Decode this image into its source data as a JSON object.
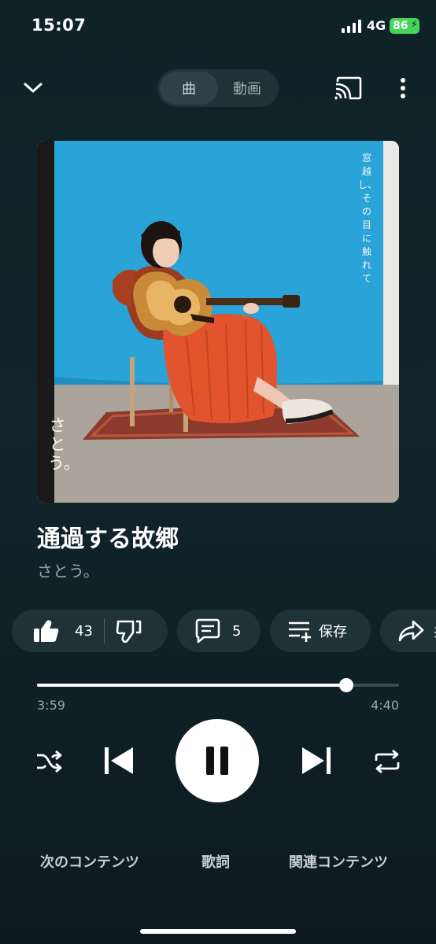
{
  "status_bar": {
    "time": "15:07",
    "network": "4G",
    "battery": "86"
  },
  "header": {
    "tabs": [
      {
        "label": "曲",
        "active": true
      },
      {
        "label": "動画",
        "active": false
      }
    ],
    "icons": [
      "chevron-down-icon",
      "cast-icon",
      "more-vert-icon"
    ]
  },
  "artwork": {
    "vertical_text": "窓越し、その目に触れて",
    "artist_text": "さとう。",
    "colors": {
      "backdrop": "#2aa3d8",
      "dress": "#e2542d",
      "floor": "#a9a39a"
    }
  },
  "track": {
    "title": "通過する故郷",
    "artist": "さとう。"
  },
  "actions": {
    "like_count": "43",
    "comment_count": "5",
    "save_label": "保存",
    "share_label_partial": "共"
  },
  "progress": {
    "current": "3:59",
    "total": "4:40",
    "fraction": 0.8535
  },
  "bottom_tabs": {
    "up_next": "次のコンテンツ",
    "lyrics": "歌詞",
    "related": "関連コンテンツ"
  },
  "colors": {
    "background": "#102027",
    "chip": "#1f3237",
    "accent": "#ffffff"
  }
}
